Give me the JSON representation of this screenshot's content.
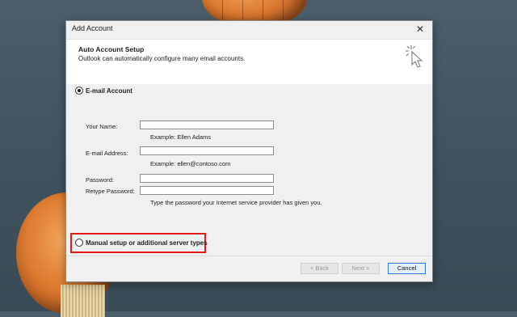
{
  "window": {
    "title": "Add Account"
  },
  "header": {
    "title": "Auto Account Setup",
    "subtitle": "Outlook can automatically configure many email accounts."
  },
  "options": {
    "email_account": {
      "label": "E-mail Account",
      "selected": true
    },
    "manual_setup": {
      "label": "Manual setup or additional server types",
      "selected": false
    }
  },
  "fields": {
    "name": {
      "label": "Your Name:",
      "value": "",
      "hint": "Example: Ellen Adams"
    },
    "email": {
      "label": "E-mail Address:",
      "value": "",
      "hint": "Example: ellen@contoso.com"
    },
    "password": {
      "label": "Password:",
      "value": ""
    },
    "retype_password": {
      "label": "Retype Password:",
      "value": "",
      "hint": "Type the password your Internet service provider has given you."
    }
  },
  "buttons": {
    "back": "< Back",
    "next": "Next >",
    "cancel": "Cancel"
  },
  "colors": {
    "highlight": "#e21b1b",
    "primary_border": "#2f7bd7"
  },
  "icons": {
    "close": "close-icon",
    "setup": "cursor-sparkle-icon"
  }
}
